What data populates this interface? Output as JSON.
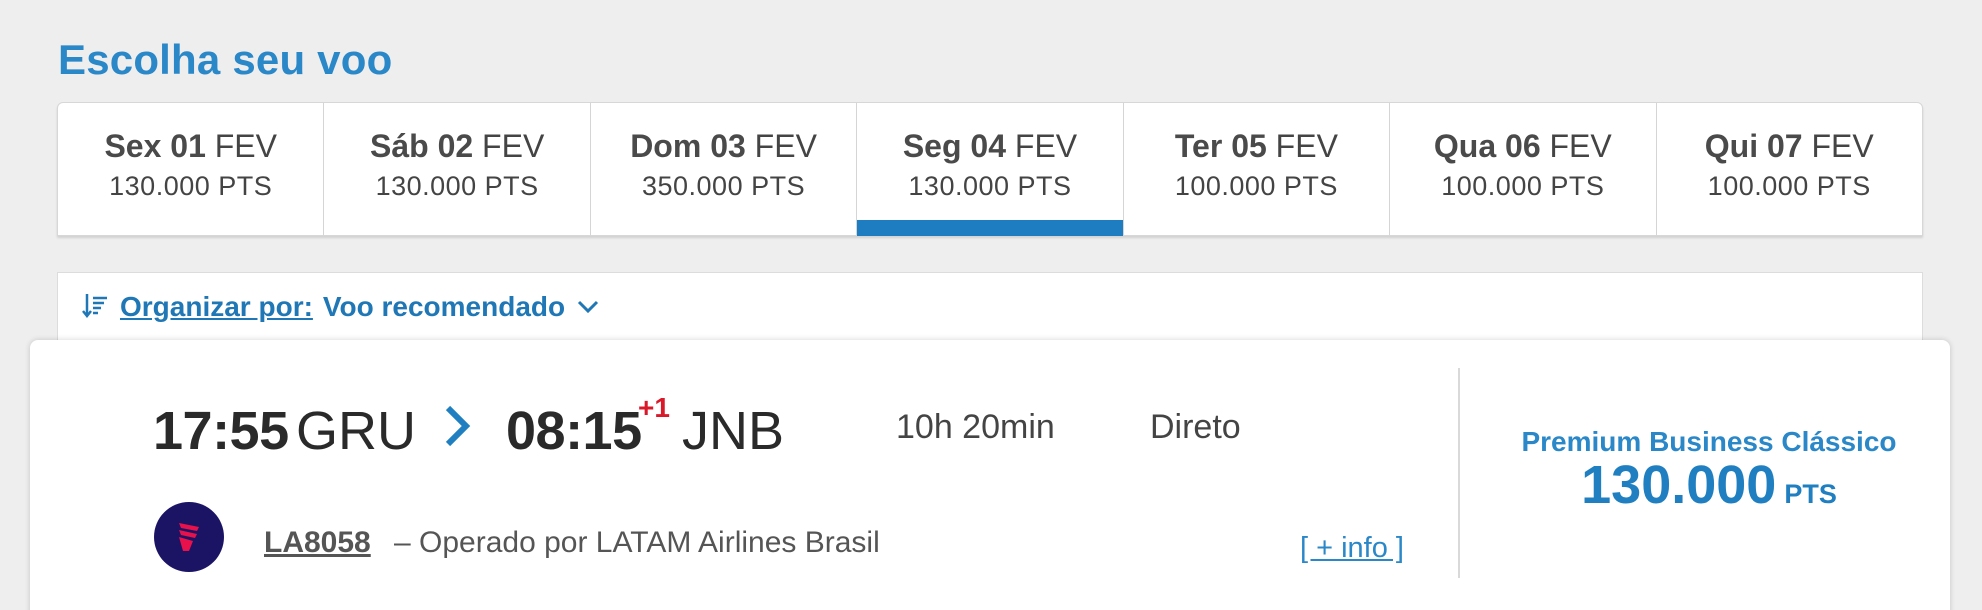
{
  "page": {
    "title": "Escolha seu voo"
  },
  "date_tabs": [
    {
      "weekday_day": "Sex 01",
      "month": "FEV",
      "points": "130.000 PTS",
      "selected": false
    },
    {
      "weekday_day": "Sáb 02",
      "month": "FEV",
      "points": "130.000 PTS",
      "selected": false
    },
    {
      "weekday_day": "Dom 03",
      "month": "FEV",
      "points": "350.000 PTS",
      "selected": false
    },
    {
      "weekday_day": "Seg 04",
      "month": "FEV",
      "points": "130.000 PTS",
      "selected": true
    },
    {
      "weekday_day": "Ter 05",
      "month": "FEV",
      "points": "100.000 PTS",
      "selected": false
    },
    {
      "weekday_day": "Qua 06",
      "month": "FEV",
      "points": "100.000 PTS",
      "selected": false
    },
    {
      "weekday_day": "Qui 07",
      "month": "FEV",
      "points": "100.000 PTS",
      "selected": false
    }
  ],
  "sort": {
    "label": "Organizar por:",
    "value": "Voo recomendado",
    "icon": "sort-icon"
  },
  "flight": {
    "departure_time": "17:55",
    "departure_airport": "GRU",
    "arrival_time": "08:15",
    "day_offset": "+1",
    "arrival_airport": "JNB",
    "duration": "10h 20min",
    "stops": "Direto",
    "flight_number": "LA8058",
    "operated_by": "– Operado por LATAM Airlines Brasil",
    "more_info": "[ + info ]",
    "fare_class": "Premium Business Clássico",
    "fare_amount": "130.000",
    "fare_unit": "PTS"
  },
  "colors": {
    "accent": "#2a87c8",
    "selected_tab": "#1e7cc1",
    "day_offset": "#d9182a",
    "logo_bg": "#1b1464"
  }
}
